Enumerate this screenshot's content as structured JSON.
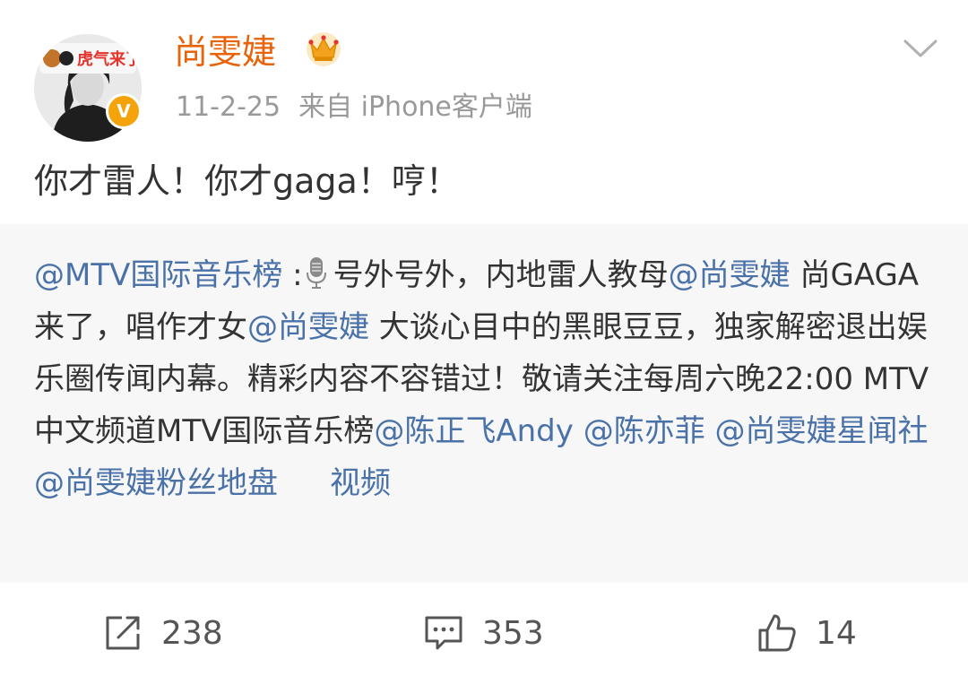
{
  "post": {
    "author": {
      "name": "尚雯婕",
      "avatar_caption": "虎气来了",
      "verified_badge": "V",
      "vip_icon": "crown-icon"
    },
    "meta": {
      "date": "11-2-25",
      "source": "来自 iPhone客户端"
    },
    "text": "你才雷人！你才gaga！哼！",
    "repost": {
      "author_mention": "@MTV国际音乐榜",
      "colon": " :",
      "icon": "microphone-icon",
      "text_1": "号外号外，内地雷人教母",
      "mention_1": "@尚雯婕",
      "text_2": " 尚GAGA来了，唱作才女",
      "mention_2": "@尚雯婕",
      "text_3": " 大谈心目中的黑眼豆豆，独家解密退出娱乐圈传闻内幕。精彩内容不容错过！敬请关注每周六晚22:00 MTV中文频道MTV国际音乐榜",
      "mention_3": "@陈正飞Andy",
      "mention_4": " @陈亦菲",
      "mention_5": " @尚雯婕星闻社",
      "mention_6": " @尚雯婕粉丝地盘",
      "video_link": "视频"
    }
  },
  "actions": {
    "repost": {
      "icon": "share-icon",
      "count": "238"
    },
    "comment": {
      "icon": "comment-icon",
      "count": "353"
    },
    "like": {
      "icon": "thumbs-up-icon",
      "count": "14"
    }
  },
  "colors": {
    "author": "#e8630a",
    "link": "#4a72a8",
    "meta": "#999999",
    "repost_bg": "#f7f7f7"
  }
}
